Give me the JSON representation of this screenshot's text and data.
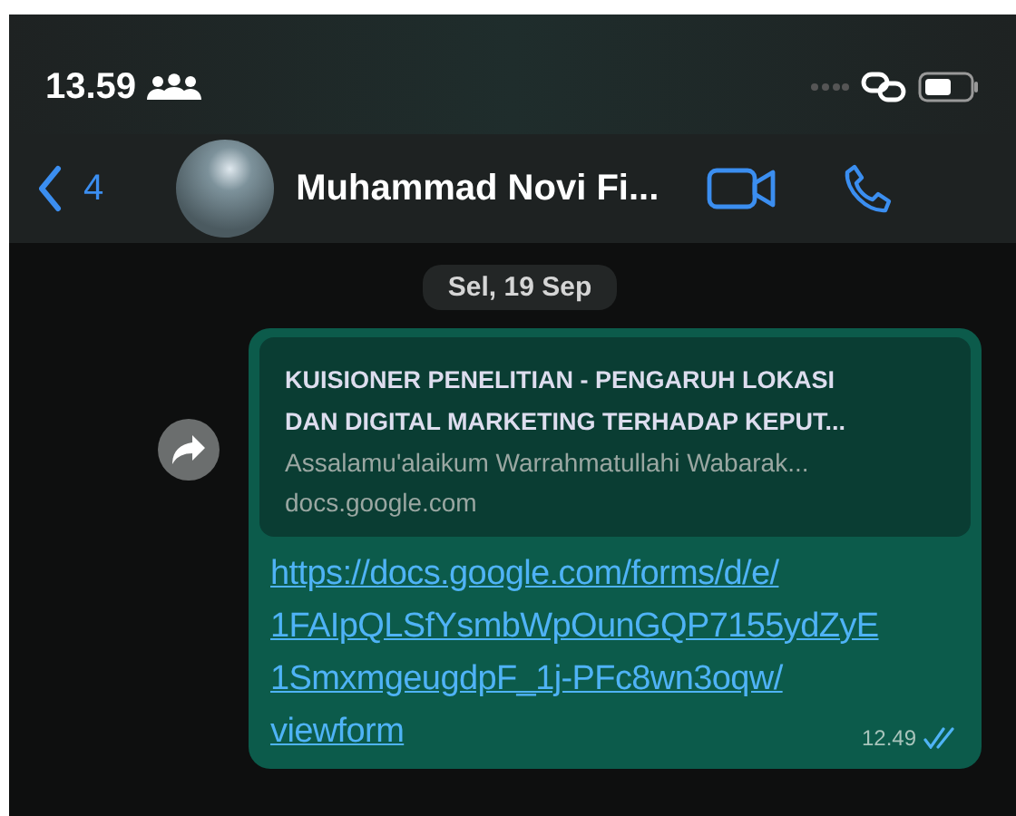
{
  "status_bar": {
    "time": "13.59"
  },
  "header": {
    "back_count": "4",
    "contact_name": "Muhammad Novi Fi..."
  },
  "date_separator": "Sel, 19 Sep",
  "message": {
    "preview": {
      "title": "KUISIONER PENELITIAN - PENGARUH LOKASI DAN DIGITAL MARKETING TERHADAP KEPUT...",
      "description": "Assalamu'alaikum Warrahmatullahi Wabarak...",
      "domain": "docs.google.com"
    },
    "link_lines": [
      "https://docs.google.com/forms/d/e/",
      "1FAIpQLSfYsmbWpOunGQP7155ydZyE",
      "1SmxmgeugdpF_1j-PFc8wn3oqw/",
      "viewform"
    ],
    "time": "12.49",
    "read": true
  }
}
